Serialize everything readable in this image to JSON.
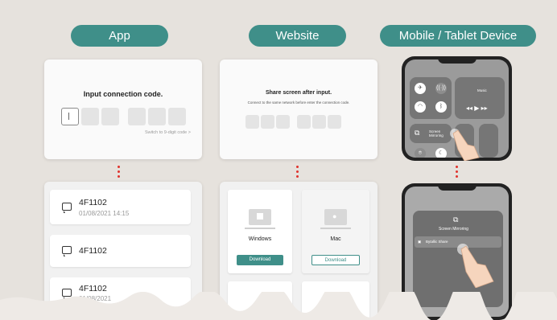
{
  "headers": {
    "app": "App",
    "website": "Website",
    "mobile": "Mobile / Tablet Device"
  },
  "app_code": {
    "title": "Input connection code.",
    "switch_link": "Switch to 9-digit code >"
  },
  "website_code": {
    "title": "Share screen after input.",
    "subtitle": "Connect to the same network before enter the connection code."
  },
  "app_list": [
    {
      "name": "4F1102",
      "date": "01/08/2021 14:15"
    },
    {
      "name": "4F1102",
      "date": ""
    },
    {
      "name": "4F1102",
      "date": "01/08/2021"
    }
  ],
  "downloads": {
    "windows": {
      "name": "Windows",
      "button": "Download"
    },
    "mac": {
      "name": "Mac",
      "button": "Download"
    }
  },
  "mobile": {
    "music_label": "Music",
    "mirroring_tile_label": "Screen Mirroring",
    "popup_title": "Screen Mirroring",
    "popup_item": "Bytallic Share"
  },
  "colors": {
    "accent": "#3f8f89",
    "dots": "#e0332d",
    "background": "#e6e2dd"
  }
}
